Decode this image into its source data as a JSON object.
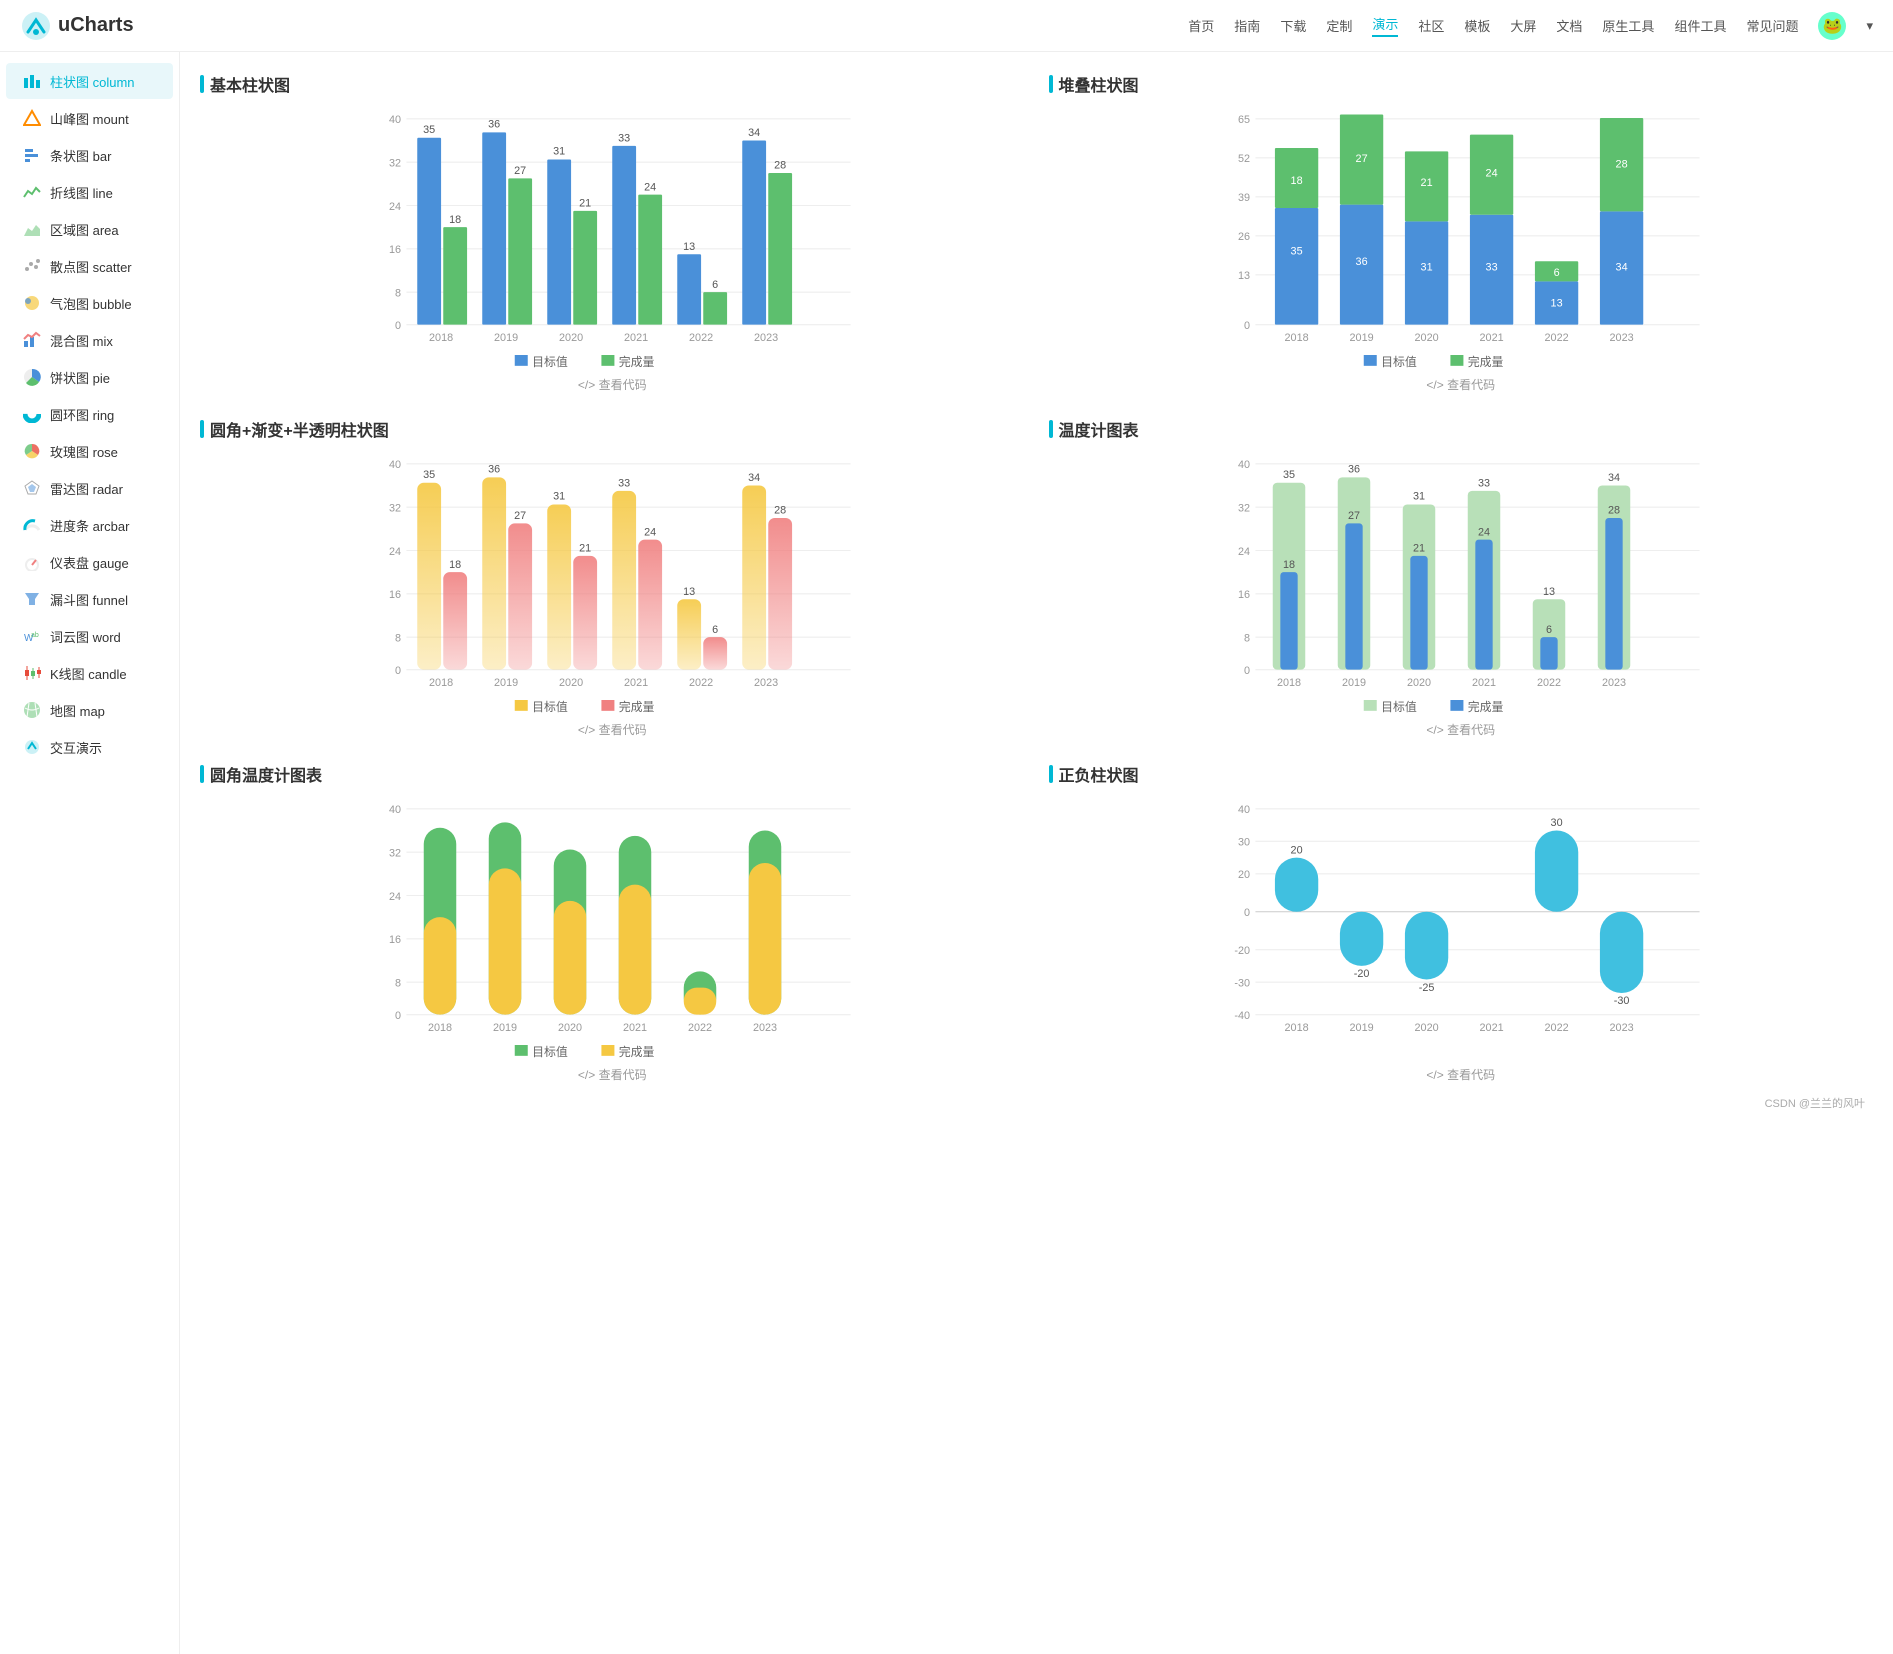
{
  "header": {
    "logo_text": "uCharts",
    "nav_items": [
      "首页",
      "指南",
      "下载",
      "定制",
      "演示",
      "社区",
      "模板",
      "大屏",
      "文档",
      "原生工具",
      "组件工具",
      "常见问题"
    ],
    "active_nav": "演示"
  },
  "sidebar": {
    "items": [
      {
        "label": "柱状图 column",
        "icon": "bar-chart",
        "active": true
      },
      {
        "label": "山峰图 mount",
        "icon": "mountain"
      },
      {
        "label": "条状图 bar",
        "icon": "bar-h"
      },
      {
        "label": "折线图 line",
        "icon": "line"
      },
      {
        "label": "区域图 area",
        "icon": "area"
      },
      {
        "label": "散点图 scatter",
        "icon": "scatter"
      },
      {
        "label": "气泡图 bubble",
        "icon": "bubble"
      },
      {
        "label": "混合图 mix",
        "icon": "mix"
      },
      {
        "label": "饼状图 pie",
        "icon": "pie"
      },
      {
        "label": "圆环图 ring",
        "icon": "ring"
      },
      {
        "label": "玫瑰图 rose",
        "icon": "rose"
      },
      {
        "label": "雷达图 radar",
        "icon": "radar"
      },
      {
        "label": "进度条 arcbar",
        "icon": "arcbar"
      },
      {
        "label": "仪表盘 gauge",
        "icon": "gauge"
      },
      {
        "label": "漏斗图 funnel",
        "icon": "funnel"
      },
      {
        "label": "词云图 word",
        "icon": "word"
      },
      {
        "label": "K线图 candle",
        "icon": "candle"
      },
      {
        "label": "地图 map",
        "icon": "map"
      },
      {
        "label": "交互演示",
        "icon": "interact"
      }
    ]
  },
  "charts": {
    "basic_column": {
      "title": "基本柱状图",
      "years": [
        "2018",
        "2019",
        "2020",
        "2021",
        "2022",
        "2023"
      ],
      "target": [
        35,
        36,
        31,
        33,
        13,
        34
      ],
      "actual": [
        18,
        27,
        21,
        24,
        6,
        28
      ],
      "y_max": 40,
      "legend": [
        "目标值",
        "完成量"
      ],
      "colors": [
        "#4a90d9",
        "#5dbf6e"
      ]
    },
    "stacked_column": {
      "title": "堆叠柱状图",
      "years": [
        "2018",
        "2019",
        "2020",
        "2021",
        "2022",
        "2023"
      ],
      "target": [
        35,
        36,
        31,
        33,
        13,
        34
      ],
      "actual": [
        18,
        27,
        21,
        24,
        6,
        28
      ],
      "y_max": 65,
      "legend": [
        "目标值",
        "完成量"
      ],
      "colors": [
        "#4a90d9",
        "#5dbf6e"
      ]
    },
    "rounded_gradient": {
      "title": "圆角+渐变+半透明柱状图",
      "years": [
        "2018",
        "2019",
        "2020",
        "2021",
        "2022",
        "2023"
      ],
      "target": [
        35,
        36,
        31,
        33,
        13,
        34
      ],
      "actual": [
        18,
        27,
        21,
        24,
        6,
        28
      ],
      "y_max": 40,
      "legend": [
        "目标值",
        "完成量"
      ],
      "colors": [
        "#f5c842",
        "#f08080"
      ]
    },
    "thermometer": {
      "title": "温度计图表",
      "years": [
        "2018",
        "2019",
        "2020",
        "2021",
        "2022",
        "2023"
      ],
      "target": [
        35,
        36,
        31,
        33,
        13,
        34
      ],
      "actual": [
        18,
        27,
        21,
        24,
        6,
        28
      ],
      "y_max": 40,
      "legend": [
        "目标值",
        "完成量"
      ],
      "colors": [
        "#b8e0b8",
        "#4a90d9"
      ]
    },
    "rounded_thermometer": {
      "title": "圆角温度计图表",
      "years": [
        "2018",
        "2019",
        "2020",
        "2021",
        "2022",
        "2023"
      ],
      "target": [
        35,
        36,
        31,
        33,
        13,
        34
      ],
      "actual": [
        18,
        27,
        21,
        24,
        6,
        28
      ],
      "y_max": 40,
      "legend": [
        "目标值",
        "完成量"
      ],
      "colors": [
        "#5dbf6e",
        "#f5c842"
      ]
    },
    "positive_negative": {
      "title": "正负柱状图",
      "years": [
        "2018",
        "2019",
        "2020",
        "2021",
        "2022",
        "2023"
      ],
      "values": [
        20,
        -20,
        -25,
        0,
        30,
        -30
      ],
      "y_max": 40,
      "y_min": -40,
      "color": "#40c0e0"
    }
  },
  "code_link_text": "</> 查看代码"
}
